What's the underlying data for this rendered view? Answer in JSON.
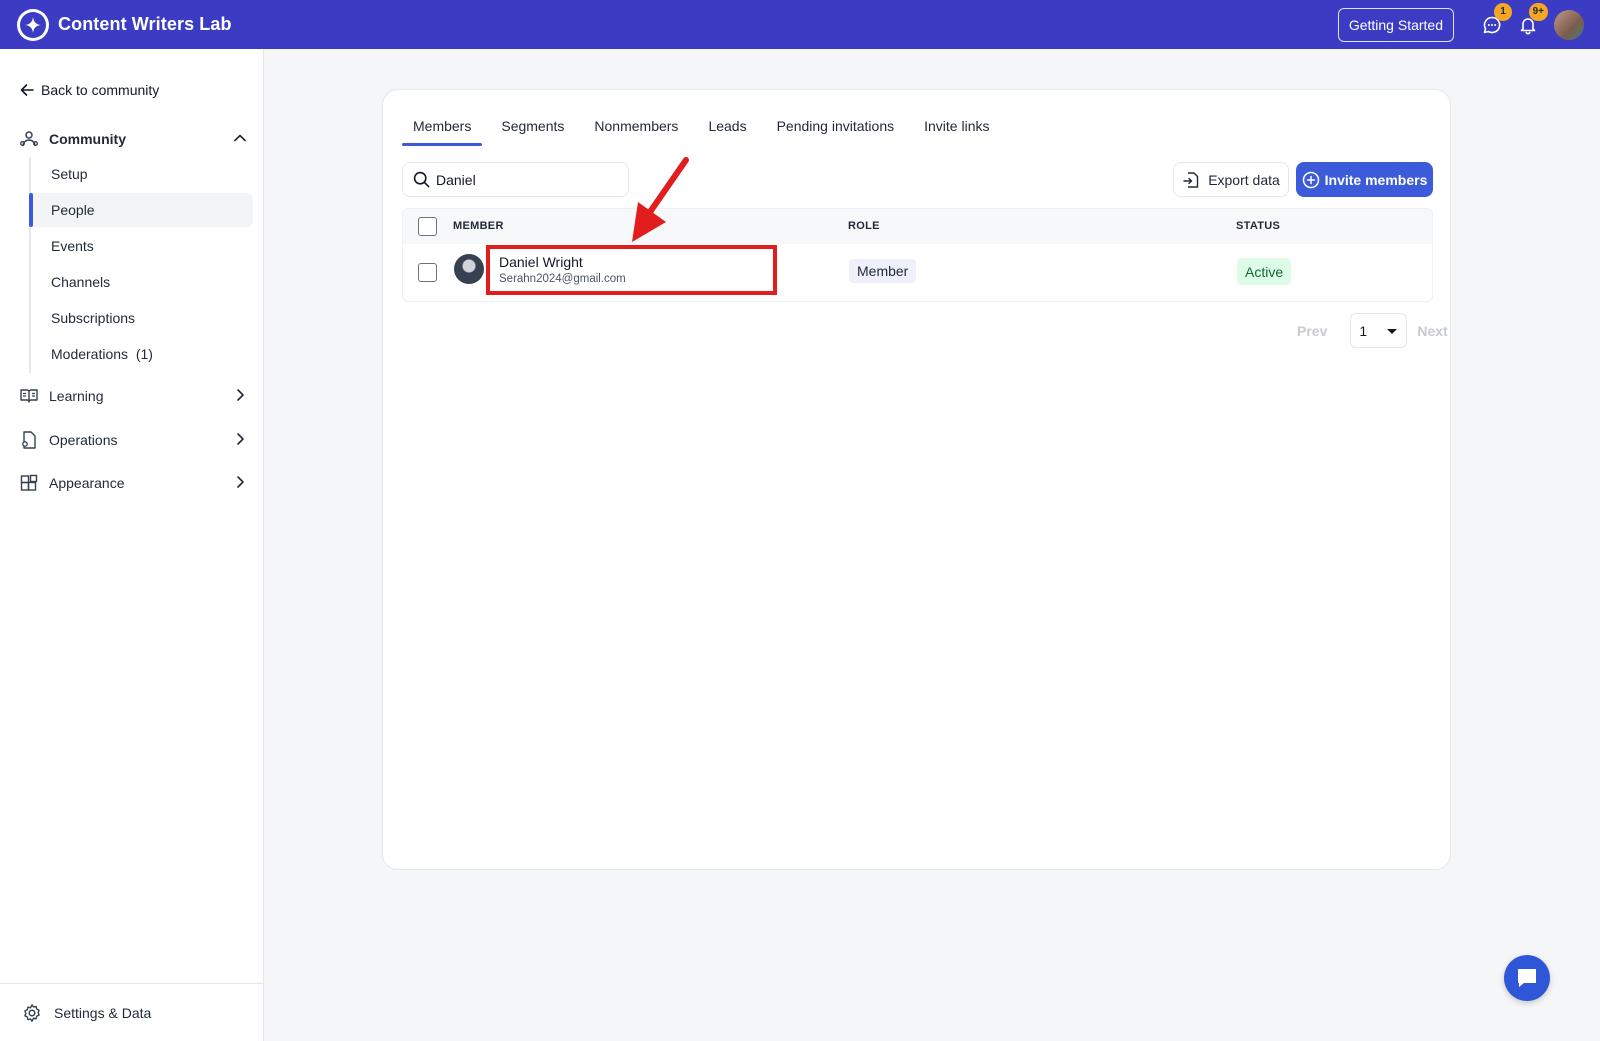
{
  "app": {
    "name": "Content Writers Lab",
    "getting_started": "Getting Started",
    "messages_badge": "1",
    "notifications_badge": "9+"
  },
  "sidebar": {
    "back_label": "Back to community",
    "community_label": "Community",
    "community_items": [
      {
        "label": "Setup"
      },
      {
        "label": "People",
        "active": true
      },
      {
        "label": "Events"
      },
      {
        "label": "Channels"
      },
      {
        "label": "Subscriptions"
      },
      {
        "label": "Moderations  (1)"
      }
    ],
    "sections": [
      {
        "label": "Learning",
        "icon": "book-icon"
      },
      {
        "label": "Operations",
        "icon": "document-icon"
      },
      {
        "label": "Appearance",
        "icon": "widgets-icon"
      }
    ],
    "footer_label": "Settings & Data"
  },
  "main": {
    "tabs": [
      {
        "label": "Members",
        "active": true
      },
      {
        "label": "Segments"
      },
      {
        "label": "Nonmembers"
      },
      {
        "label": "Leads"
      },
      {
        "label": "Pending invitations"
      },
      {
        "label": "Invite links"
      }
    ],
    "search_value": "Daniel",
    "export_label": "Export data",
    "invite_label": "Invite members",
    "columns": {
      "member": "MEMBER",
      "role": "ROLE",
      "status": "STATUS"
    },
    "rows": [
      {
        "name": "Daniel Wright",
        "email": "Serahn2024@gmail.com",
        "role": "Member",
        "status": "Active"
      }
    ],
    "pager": {
      "prev": "Prev",
      "page": "1",
      "next": "Next"
    }
  },
  "colors": {
    "brand": "#3b3bc4",
    "accent": "#3b5bdb",
    "annotation": "#e11d1d",
    "status_active_bg": "#dcfce7"
  }
}
